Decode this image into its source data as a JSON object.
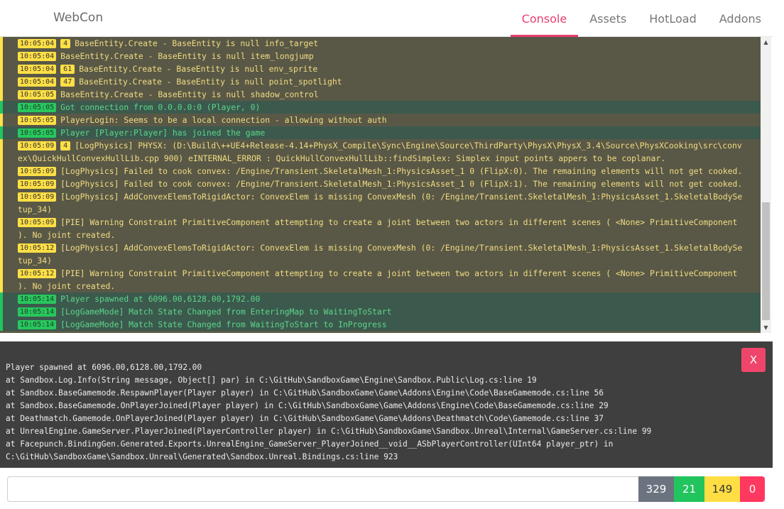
{
  "header": {
    "brand": "WebCon",
    "tabs": [
      {
        "label": "Console",
        "active": true
      },
      {
        "label": "Assets",
        "active": false
      },
      {
        "label": "HotLoad",
        "active": false
      },
      {
        "label": "Addons",
        "active": false
      }
    ]
  },
  "log": [
    {
      "level": "warn",
      "time": "10:05:04",
      "count": "4",
      "text": "BaseEntity.Create - BaseEntity is null info_target"
    },
    {
      "level": "warn",
      "time": "10:05:04",
      "count": "",
      "text": "BaseEntity.Create - BaseEntity is null item_longjump"
    },
    {
      "level": "warn",
      "time": "10:05:04",
      "count": "61",
      "text": "BaseEntity.Create - BaseEntity is null env_sprite"
    },
    {
      "level": "warn",
      "time": "10:05:04",
      "count": "47",
      "text": "BaseEntity.Create - BaseEntity is null point_spotlight"
    },
    {
      "level": "warn",
      "time": "10:05:05",
      "count": "",
      "text": "BaseEntity.Create - BaseEntity is null shadow_control"
    },
    {
      "level": "info",
      "time": "10:05:05",
      "count": "",
      "text": "Got connection from 0.0.0.0:0 (Player, 0)"
    },
    {
      "level": "warn",
      "time": "10:05:05",
      "count": "",
      "text": "PlayerLogin: Seems to be a local connection - allowing without auth"
    },
    {
      "level": "info",
      "time": "10:05:05",
      "count": "",
      "text": "Player [Player:Player] has joined the game"
    },
    {
      "level": "warn",
      "time": "10:05:09",
      "count": "4",
      "text": "[LogPhysics] PHYSX: (D:\\Build\\++UE4+Release-4.14+PhysX_Compile\\Sync\\Engine\\Source\\ThirdParty\\PhysX\\PhysX_3.4\\Source\\PhysXCooking\\src\\convex\\QuickHullConvexHullLib.cpp 900) eINTERNAL_ERROR : QuickHullConvexHullLib::findSimplex: Simplex input points appers to be coplanar."
    },
    {
      "level": "warn",
      "time": "10:05:09",
      "count": "",
      "text": "[LogPhysics] Failed to cook convex: /Engine/Transient.SkeletalMesh_1:PhysicsAsset_1 0 (FlipX:0). The remaining elements will not get cooked."
    },
    {
      "level": "warn",
      "time": "10:05:09",
      "count": "",
      "text": "[LogPhysics] Failed to cook convex: /Engine/Transient.SkeletalMesh_1:PhysicsAsset_1 0 (FlipX:1). The remaining elements will not get cooked."
    },
    {
      "level": "warn",
      "time": "10:05:09",
      "count": "",
      "text": "[LogPhysics] AddConvexElemsToRigidActor: ConvexElem is missing ConvexMesh (0: /Engine/Transient.SkeletalMesh_1:PhysicsAsset_1.SkeletalBodySetup_34)"
    },
    {
      "level": "warn",
      "time": "10:05:09",
      "count": "",
      "text": "[PIE] Warning Constraint PrimitiveComponent attempting to create a joint between two actors in different scenes ( <None> PrimitiveComponent ). No joint created."
    },
    {
      "level": "warn",
      "time": "10:05:12",
      "count": "",
      "text": "[LogPhysics] AddConvexElemsToRigidActor: ConvexElem is missing ConvexMesh (0: /Engine/Transient.SkeletalMesh_1:PhysicsAsset_1.SkeletalBodySetup_34)"
    },
    {
      "level": "warn",
      "time": "10:05:12",
      "count": "",
      "text": "[PIE] Warning Constraint PrimitiveComponent attempting to create a joint between two actors in different scenes ( <None> PrimitiveComponent ). No joint created."
    },
    {
      "level": "info",
      "time": "10:05:14",
      "count": "",
      "text": "Player spawned at 6096.00,6128.00,1792.00"
    },
    {
      "level": "info",
      "time": "10:05:14",
      "count": "",
      "text": "[LogGameMode] Match State Changed from EnteringMap to WaitingToStart"
    },
    {
      "level": "info",
      "time": "10:05:14",
      "count": "",
      "text": "[LogGameMode] Match State Changed from WaitingToStart to InProgress"
    }
  ],
  "detail": {
    "close_label": "X",
    "text": "Player spawned at 6096.00,6128.00,1792.00\nat Sandbox.Log.Info(String message, Object[] par) in C:\\GitHub\\SandboxGame\\Engine\\Sandbox.Public\\Log.cs:line 19\nat Sandbox.BaseGamemode.RespawnPlayer(Player player) in C:\\GitHub\\SandboxGame\\Game\\Addons\\Engine\\Code\\BaseGamemode.cs:line 56\nat Sandbox.BaseGamemode.OnPlayerJoined(Player player) in C:\\GitHub\\SandboxGame\\Game\\Addons\\Engine\\Code\\BaseGamemode.cs:line 29\nat Deathmatch.Gamemode.OnPlayerJoined(Player player) in C:\\GitHub\\SandboxGame\\Game\\Addons\\Deathmatch\\Code\\Gamemode.cs:line 37\nat UnrealEngine.GameServer.PlayerJoined(PlayerController player) in C:\\GitHub\\SandboxGame\\Sandbox.Unreal\\Internal\\GameServer.cs:line 99\nat Facepunch.BindingGen.Generated.Exports.UnrealEngine_GameServer_PlayerJoined__void__ASbPlayerController(UInt64 player_ptr) in C:\\GitHub\\SandboxGame\\Sandbox.Unreal\\Generated\\Sandbox.Unreal.Bindings.cs:line 923"
  },
  "command": {
    "value": "",
    "placeholder": ""
  },
  "counts": {
    "total": "329",
    "info": "21",
    "warnings": "149",
    "errors": "0"
  },
  "colors": {
    "accent": "#e83e6c",
    "warn": "#ffdf45",
    "info": "#28c75d",
    "error": "#ff3860",
    "neutral": "#6c7380"
  },
  "icons": {
    "scroll_up": "chevron-up-icon",
    "scroll_down": "chevron-down-icon"
  }
}
